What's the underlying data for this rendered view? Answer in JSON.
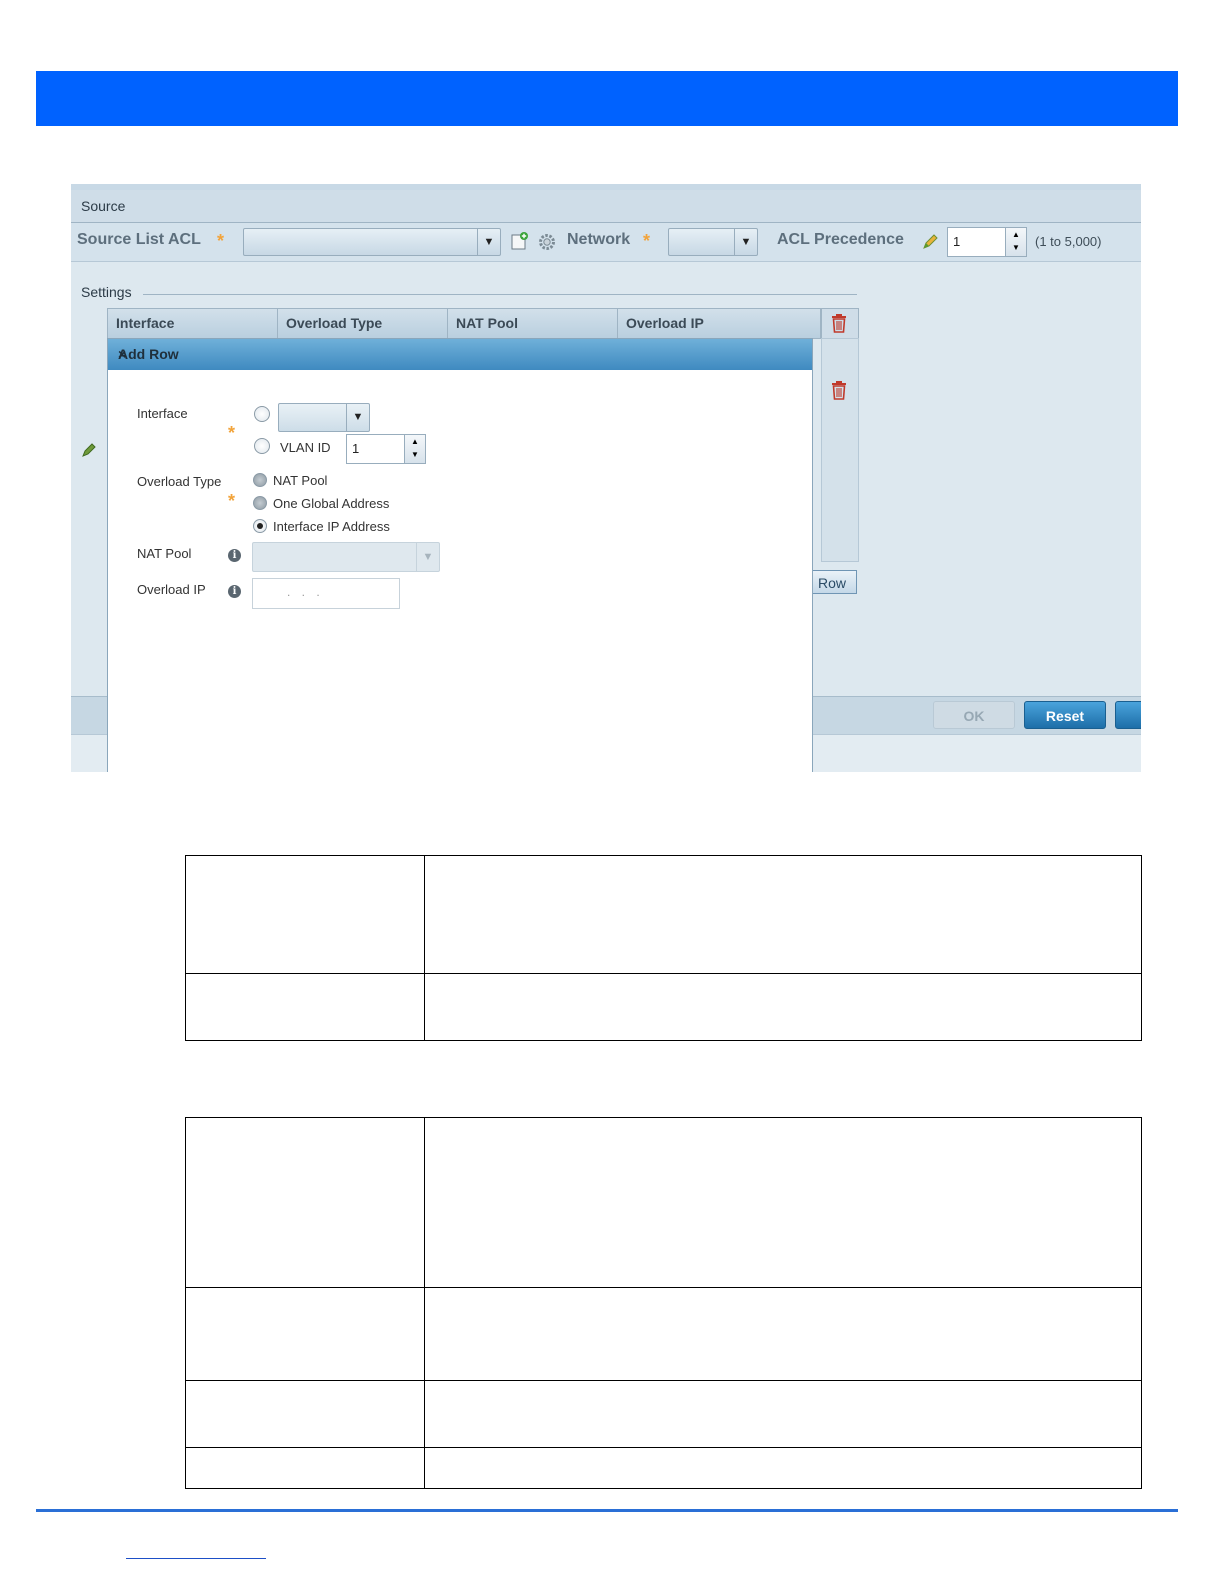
{
  "screenshot": {
    "source_header": "Source",
    "source_list_acl_label": "Source List ACL",
    "network_label": "Network",
    "acl_precedence_label": "ACL Precedence",
    "acl_precedence_value": "1",
    "acl_precedence_range": "(1 to 5,000)",
    "settings_label": "Settings",
    "grid_columns": [
      "Interface",
      "Overload Type",
      "NAT Pool",
      "Overload IP"
    ],
    "add_row_button_text": "Row",
    "ok_label": "OK",
    "reset_label": "Reset",
    "colors": {
      "banner": "#0062ff",
      "accent_star": "#f2a33a",
      "trash": "#c0392b"
    }
  },
  "modal": {
    "title": "Add Row",
    "close_glyph": "×",
    "interface_label": "Interface",
    "vlan_label": "VLAN ID",
    "vlan_value": "1",
    "overload_type_label": "Overload Type",
    "overload_options": [
      "NAT Pool",
      "One Global Address",
      "Interface IP Address"
    ],
    "overload_selected": "Interface IP Address",
    "nat_pool_label": "NAT Pool",
    "overload_ip_label": "Overload IP",
    "overload_ip_placeholder": ".   .   .",
    "required_glyph": "*",
    "info_glyph": "i"
  }
}
